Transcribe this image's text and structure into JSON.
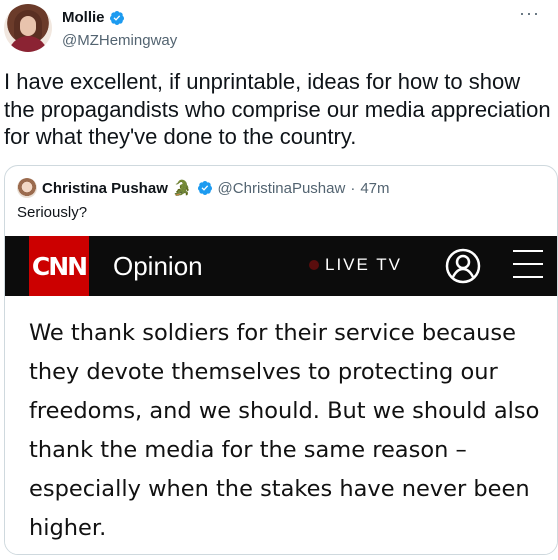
{
  "tweet": {
    "author": {
      "display_name": "Mollie",
      "handle": "@MZHemingway",
      "verified": true
    },
    "text": "I have excellent, if unprintable, ideas for how to show the propagandists who comprise our media appreciation for what they've done to the country."
  },
  "quote": {
    "author": {
      "display_name": "Christina Pushaw",
      "emoji": "🐊",
      "handle": "@ChristinaPushaw",
      "time": "47m",
      "verified": true
    },
    "separator": "·",
    "text": "Seriously?",
    "screenshot": {
      "logo": "CNN",
      "section": "Opinion",
      "live_label": "LIVE TV",
      "article_text": "We thank soldiers for their service because they devote themselves to protecting our freedoms, and we should. But we should also thank the media for the same reason – especially when the stakes have never been higher."
    }
  },
  "colors": {
    "verified": "#1d9bf0",
    "cnn_red": "#cc0000",
    "cnn_bar": "#0c0c0c"
  },
  "icons": [
    "verified-badge-icon",
    "more-icon",
    "crocodile-emoji-icon",
    "live-dot-icon",
    "account-icon",
    "menu-icon"
  ]
}
